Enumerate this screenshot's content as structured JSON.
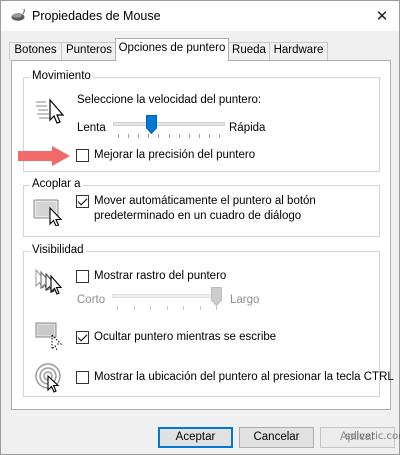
{
  "window": {
    "title": "Propiedades de Mouse",
    "close_glyph": "✕"
  },
  "tabs": [
    {
      "label": "Botones"
    },
    {
      "label": "Punteros"
    },
    {
      "label": "Opciones de puntero",
      "active": true
    },
    {
      "label": "Rueda"
    },
    {
      "label": "Hardware"
    }
  ],
  "movement": {
    "group_label": "Movimiento",
    "speed_label": "Seleccione la velocidad del puntero:",
    "slow_label": "Lenta",
    "fast_label": "Rápida",
    "speed_level_fraction": 0.33,
    "precision": {
      "label": "Mejorar la precisión del puntero",
      "checked": false
    }
  },
  "snap_to": {
    "group_label": "Acoplar a",
    "label_line1": "Mover automáticamente el puntero al botón",
    "label_line2": "predeterminado en un cuadro de diálogo",
    "checked": true
  },
  "visibility": {
    "group_label": "Visibilidad",
    "trails": {
      "label": "Mostrar rastro del puntero",
      "checked": false
    },
    "short_label": "Corto",
    "long_label": "Largo",
    "trail_level_fraction": 1.0,
    "hide_typing": {
      "label": "Ocultar puntero mientras se escribe",
      "checked": true
    },
    "show_ctrl": {
      "label": "Mostrar la ubicación del puntero al presionar la tecla CTRL",
      "checked": false
    }
  },
  "buttons": {
    "accept": "Aceptar",
    "cancel": "Cancelar",
    "apply": "Aplicar"
  },
  "watermark": "solvetic.com",
  "colors": {
    "accent": "#0078d7",
    "arrow": "#f26b6b"
  }
}
